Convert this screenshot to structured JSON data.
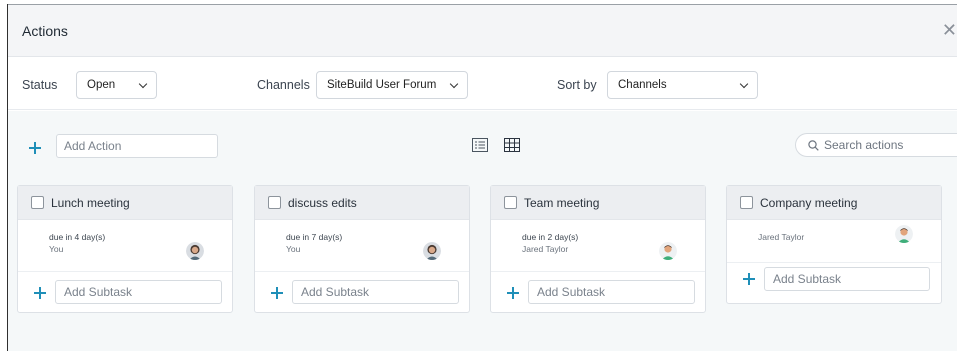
{
  "dialog": {
    "title": "Actions",
    "close_icon": "close-icon"
  },
  "filters": {
    "status_label": "Status",
    "status_value": "Open",
    "channels_label": "Channels",
    "channels_value": "SiteBuild User Forum",
    "sortby_label": "Sort by",
    "sortby_value": "Channels"
  },
  "toolbar": {
    "add_action_placeholder": "Add Action",
    "search_placeholder": "Search actions",
    "views": [
      "list-view-icon",
      "grid-view-icon"
    ]
  },
  "cards": [
    {
      "title": "Lunch meeting",
      "due": "due in 4 day(s)",
      "owner": "You",
      "avatar": "woman-avatar",
      "subtask_placeholder": "Add Subtask"
    },
    {
      "title": "discuss edits",
      "due": "due in 7 day(s)",
      "owner": "You",
      "avatar": "woman-avatar",
      "subtask_placeholder": "Add Subtask"
    },
    {
      "title": "Team meeting",
      "due": "due in 2 day(s)",
      "owner": "Jared Taylor",
      "avatar": "man-avatar",
      "subtask_placeholder": "Add Subtask"
    },
    {
      "title": "Company meeting",
      "due": "",
      "owner": "Jared Taylor",
      "avatar": "man-avatar",
      "subtask_placeholder": "Add Subtask"
    }
  ],
  "colors": {
    "accent": "#1f8fb8",
    "header_bg": "#f4f5f7",
    "board_bg": "#f5f8f9",
    "card_head_bg": "#eceef1"
  }
}
